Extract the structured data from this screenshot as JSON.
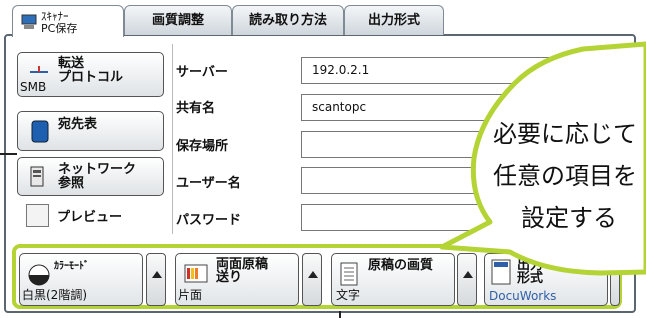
{
  "tabs": [
    {
      "label": "ｽｷｬﾅｰ\nPC保存"
    },
    {
      "label": "画質調整"
    },
    {
      "label": "読み取り方法"
    },
    {
      "label": "出力形式"
    }
  ],
  "side_buttons": {
    "protocol": {
      "label1": "転送",
      "label2": "プロトコル",
      "value": "SMB"
    },
    "destination": {
      "label": "宛先表"
    },
    "network": {
      "label1": "ネットワーク",
      "label2": "参照"
    },
    "preview": {
      "label": "プレビュー"
    }
  },
  "fields": {
    "server": {
      "label": "サーバー",
      "value": "192.0.2.1"
    },
    "share": {
      "label": "共有名",
      "value": "scantopc"
    },
    "location": {
      "label": "保存場所",
      "value": ""
    },
    "user": {
      "label": "ユーザー名",
      "value": ""
    },
    "password": {
      "label": "パスワード",
      "value": ""
    }
  },
  "bottom_buttons": {
    "color": {
      "label": "ｶﾗｰﾓｰﾄﾞ",
      "value": "白黒(2階調)"
    },
    "duplex": {
      "label1": "両面原稿",
      "label2": "送り",
      "value": "片面"
    },
    "quality": {
      "label": "原稿の画質",
      "value": "文字"
    },
    "format": {
      "label1": "出力",
      "label2": "形式",
      "value": "DocuWorks"
    }
  },
  "callout": {
    "line1": "必要に応じて",
    "line2": "任意の項目を",
    "line3": "設定する"
  },
  "colors": {
    "accent_green": "#b4d335",
    "doc_blue": "#2f5fa8"
  }
}
